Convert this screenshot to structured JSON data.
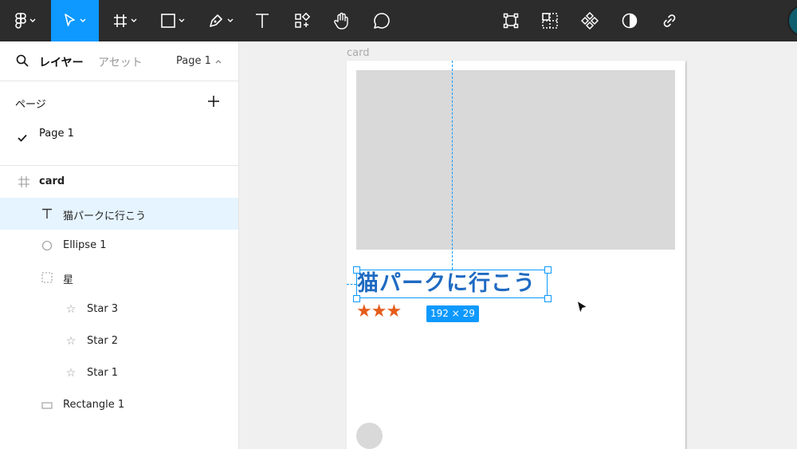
{
  "toolbar": {
    "tools": [
      {
        "name": "main-menu",
        "icon": "figma-logo-icon",
        "active": false
      },
      {
        "name": "move",
        "icon": "pointer-icon",
        "active": true
      },
      {
        "name": "frame",
        "icon": "hash-frame-icon",
        "active": false
      },
      {
        "name": "shape",
        "icon": "rectangle-icon",
        "active": false
      },
      {
        "name": "pen",
        "icon": "pen-icon",
        "active": false
      },
      {
        "name": "text",
        "icon": "text-icon",
        "active": false
      },
      {
        "name": "resources",
        "icon": "components-icon",
        "active": false
      },
      {
        "name": "hand",
        "icon": "hand-icon",
        "active": false
      },
      {
        "name": "comment",
        "icon": "comment-icon",
        "active": false
      },
      {
        "name": "edit-object",
        "icon": "bounding-box-icon",
        "active": false
      },
      {
        "name": "mask",
        "icon": "dashed-grid-icon",
        "active": false
      },
      {
        "name": "component",
        "icon": "component-diamond-icon",
        "active": false
      },
      {
        "name": "contrast",
        "icon": "half-circle-icon",
        "active": false
      },
      {
        "name": "link",
        "icon": "link-icon",
        "active": false
      }
    ],
    "accent": "#0d99ff",
    "background": "#2c2c2c"
  },
  "panel": {
    "tabs": {
      "layers": "レイヤー",
      "assets": "アセット"
    },
    "current_page": "Page 1",
    "pages_title": "ページ",
    "pages": [
      {
        "label": "Page 1",
        "checked": true
      }
    ],
    "layers": [
      {
        "label": "card",
        "icon": "frame-hash-icon",
        "indent": 0,
        "bold": true,
        "selected": false
      },
      {
        "label": "猫パークに行こう",
        "icon": "text-T-icon",
        "indent": 1,
        "bold": false,
        "selected": true
      },
      {
        "label": "Ellipse 1",
        "icon": "ellipse-icon",
        "indent": 1,
        "bold": false,
        "selected": false
      },
      {
        "label": "星",
        "icon": "group-dashed-icon",
        "indent": 1,
        "bold": false,
        "selected": false
      },
      {
        "label": "Star 3",
        "icon": "star-icon",
        "indent": 2,
        "bold": false,
        "selected": false
      },
      {
        "label": "Star 2",
        "icon": "star-icon",
        "indent": 2,
        "bold": false,
        "selected": false
      },
      {
        "label": "Star 1",
        "icon": "star-icon",
        "indent": 2,
        "bold": false,
        "selected": false
      },
      {
        "label": "Rectangle 1",
        "icon": "rectangle-icon",
        "indent": 1,
        "bold": false,
        "selected": false
      }
    ]
  },
  "canvas": {
    "frame_label": "card",
    "headline": "猫パークに行こう",
    "headline_color": "#1f6ac2",
    "stars": "★★★",
    "stars_color": "#e65c1b",
    "dimension_badge": "192 × 29"
  }
}
